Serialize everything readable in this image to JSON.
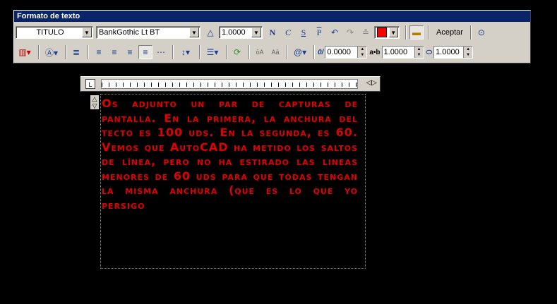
{
  "toolbar": {
    "title": "Formato de texto",
    "style_value": "TITULO",
    "font_value": "BankGothic Lt BT",
    "font_prefix": "Ŧ",
    "height_value": "1.0000",
    "accept_label": "Aceptar",
    "oblique_value": "0.0000",
    "tracking_label": "a•b",
    "tracking_value": "1.0000",
    "width_value": "1.0000",
    "text_color": "#ff0000"
  },
  "editor": {
    "text": "Os adjunto un par de capturas de pantalla. En la primera, la anchura del tecto es 100 uds. En la segunda, es 60. Vemos que AutoCAD ha metido los saltos de línea, pero no ha estirado las lineas menores de 60 uds para que todas tengan la misma anchura (que es lo que yo persigo",
    "text_color": "#e00000"
  }
}
